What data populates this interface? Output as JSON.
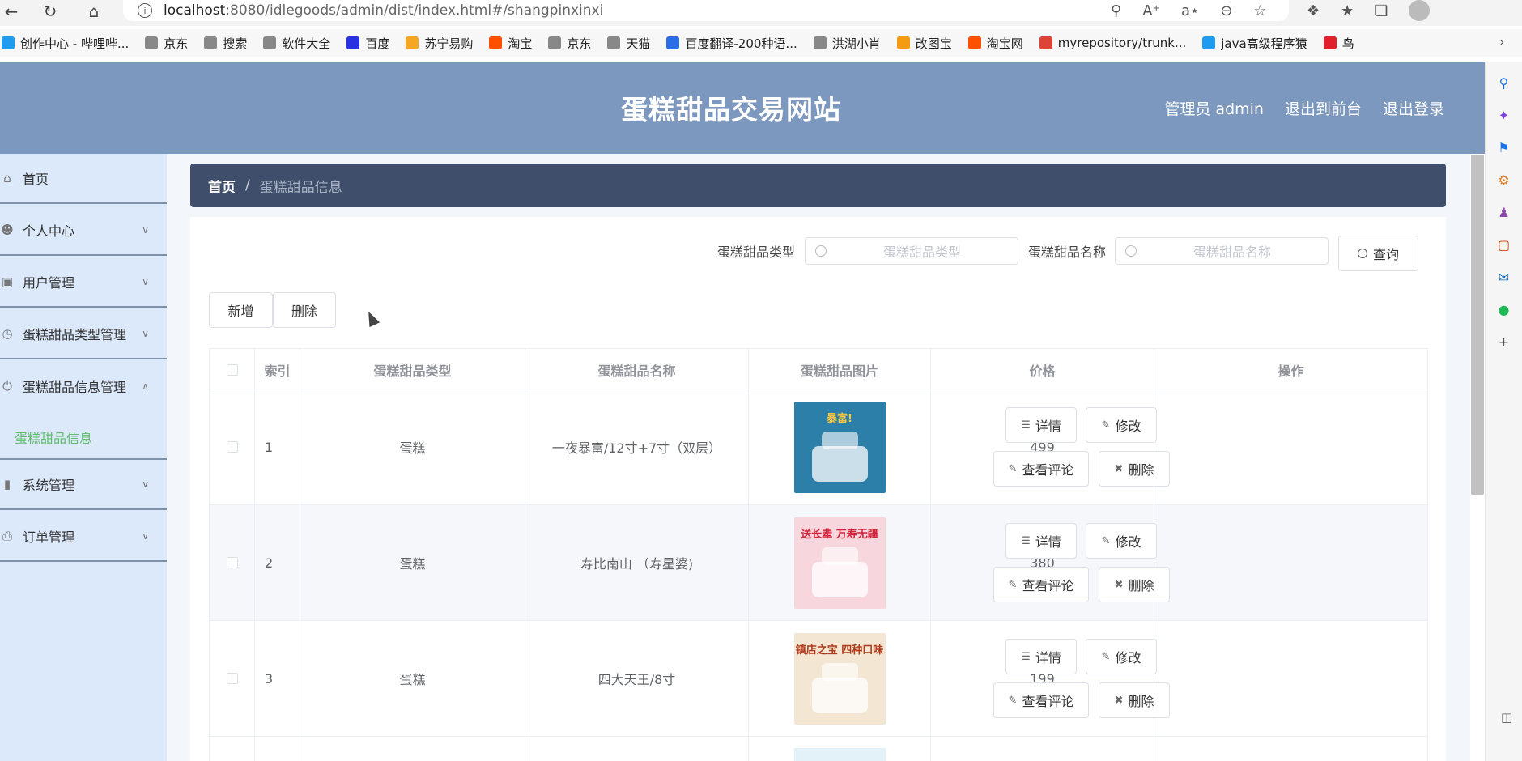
{
  "browser": {
    "url_host": "localhost",
    "url_path": ":8080/idlegoods/admin/dist/index.html#/shangpinxinxi",
    "bookmarks": [
      {
        "label": "创作中心 - 哔哩哔...",
        "icon": "bilibili-icon",
        "color": "#1f9cf0"
      },
      {
        "label": "京东",
        "icon": "page-icon",
        "color": "#888888"
      },
      {
        "label": "搜索",
        "icon": "page-icon",
        "color": "#888888"
      },
      {
        "label": "软件大全",
        "icon": "page-icon",
        "color": "#888888"
      },
      {
        "label": "百度",
        "icon": "baidu-icon",
        "color": "#2932e1"
      },
      {
        "label": "苏宁易购",
        "icon": "suning-icon",
        "color": "#f5a623"
      },
      {
        "label": "淘宝",
        "icon": "taobao-icon",
        "color": "#ff5000"
      },
      {
        "label": "京东",
        "icon": "page-icon",
        "color": "#888888"
      },
      {
        "label": "天猫",
        "icon": "page-icon",
        "color": "#888888"
      },
      {
        "label": "百度翻译-200种语...",
        "icon": "translate-icon",
        "color": "#2b6de5"
      },
      {
        "label": "洪湖小肖",
        "icon": "bird-icon",
        "color": "#888888"
      },
      {
        "label": "改图宝",
        "icon": "gaitubao-icon",
        "color": "#f39c12"
      },
      {
        "label": "淘宝网",
        "icon": "taobao-icon",
        "color": "#ff5000"
      },
      {
        "label": "myrepository/trunk...",
        "icon": "chrome-icon",
        "color": "#db4437"
      },
      {
        "label": "java高级程序猿",
        "icon": "bilibili-icon",
        "color": "#1f9cf0"
      },
      {
        "label": "鸟",
        "icon": "bird-red-icon",
        "color": "#e0202a"
      }
    ]
  },
  "header": {
    "title": "蛋糕甜品交易网站",
    "links": [
      "管理员 admin",
      "退出到前台",
      "退出登录"
    ]
  },
  "sidebar": {
    "items": [
      {
        "label": "首页",
        "icon": "home-icon",
        "expandable": false
      },
      {
        "label": "个人中心",
        "icon": "user-icon",
        "expandable": true
      },
      {
        "label": "用户管理",
        "icon": "briefcase-icon",
        "expandable": true
      },
      {
        "label": "蛋糕甜品类型管理",
        "icon": "clock-icon",
        "expandable": true
      },
      {
        "label": "蛋糕甜品信息管理",
        "icon": "power-icon",
        "expandable": true,
        "expanded": true
      },
      {
        "label": "系统管理",
        "icon": "bar-chart-icon",
        "expandable": true
      },
      {
        "label": "订单管理",
        "icon": "printer-icon",
        "expandable": true
      }
    ],
    "sub_item": "蛋糕甜品信息"
  },
  "breadcrumb": {
    "home": "首页",
    "separator": "/",
    "current": "蛋糕甜品信息"
  },
  "search": {
    "type_label": "蛋糕甜品类型",
    "type_placeholder": "蛋糕甜品类型",
    "name_label": "蛋糕甜品名称",
    "name_placeholder": "蛋糕甜品名称",
    "query_button": "查询"
  },
  "toolbar": {
    "add_button": "新增",
    "delete_button": "删除"
  },
  "table": {
    "columns": [
      "索引",
      "蛋糕甜品类型",
      "蛋糕甜品名称",
      "蛋糕甜品图片",
      "价格",
      "操作"
    ],
    "actions": {
      "detail": "详情",
      "edit": "修改",
      "reviews": "查看评论",
      "delete": "删除"
    },
    "rows": [
      {
        "index": "1",
        "type": "蛋糕",
        "name": "一夜暴富/12寸+7寸（双层）",
        "price": "499",
        "image_caption": "暴富!",
        "image_bg": "#2c7fa8",
        "image_fg": "#f5c542"
      },
      {
        "index": "2",
        "type": "蛋糕",
        "name": "寿比南山 （寿星婆)",
        "price": "380",
        "image_caption": "送长辈 万寿无疆",
        "image_bg": "#f7d6de",
        "image_fg": "#d2223a"
      },
      {
        "index": "3",
        "type": "蛋糕",
        "name": "四大天王/8寸",
        "price": "199",
        "image_caption": "镇店之宝 四种口味",
        "image_bg": "#f3e7d3",
        "image_fg": "#b03a1c"
      }
    ]
  }
}
